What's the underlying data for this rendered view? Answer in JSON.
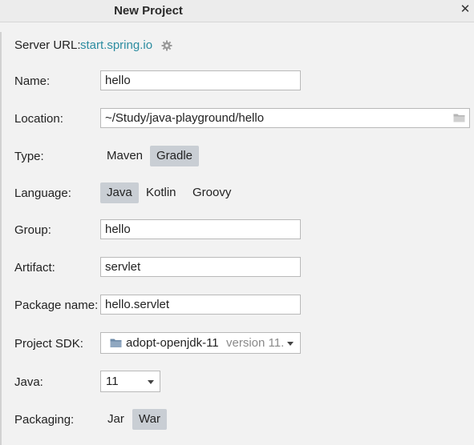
{
  "window": {
    "title": "New Project"
  },
  "server": {
    "label": "Server URL:",
    "url": "start.spring.io"
  },
  "fields": {
    "name": {
      "label": "Name:",
      "value": "hello"
    },
    "location": {
      "label": "Location:",
      "value": "~/Study/java-playground/hello"
    },
    "type": {
      "label": "Type:",
      "options": [
        "Maven",
        "Gradle"
      ],
      "selected": "Gradle"
    },
    "language": {
      "label": "Language:",
      "options": [
        "Java",
        "Kotlin",
        "Groovy"
      ],
      "selected": "Java"
    },
    "group": {
      "label": "Group:",
      "value": "hello"
    },
    "artifact": {
      "label": "Artifact:",
      "value": "servlet"
    },
    "package_name": {
      "label": "Package name:",
      "value": "hello.servlet"
    },
    "project_sdk": {
      "label": "Project SDK:",
      "value": "adopt-openjdk-11",
      "version": "version 11."
    },
    "java": {
      "label": "Java:",
      "value": "11"
    },
    "packaging": {
      "label": "Packaging:",
      "options": [
        "Jar",
        "War"
      ],
      "selected": "War"
    }
  },
  "icons": {
    "close": "close-icon",
    "settings": "gear-icon",
    "browse": "folder-icon",
    "sdk": "folder-icon",
    "dropdown": "chevron-down-icon"
  },
  "colors": {
    "link": "#2b8ca0",
    "selected_segment": "#c9ced4"
  }
}
